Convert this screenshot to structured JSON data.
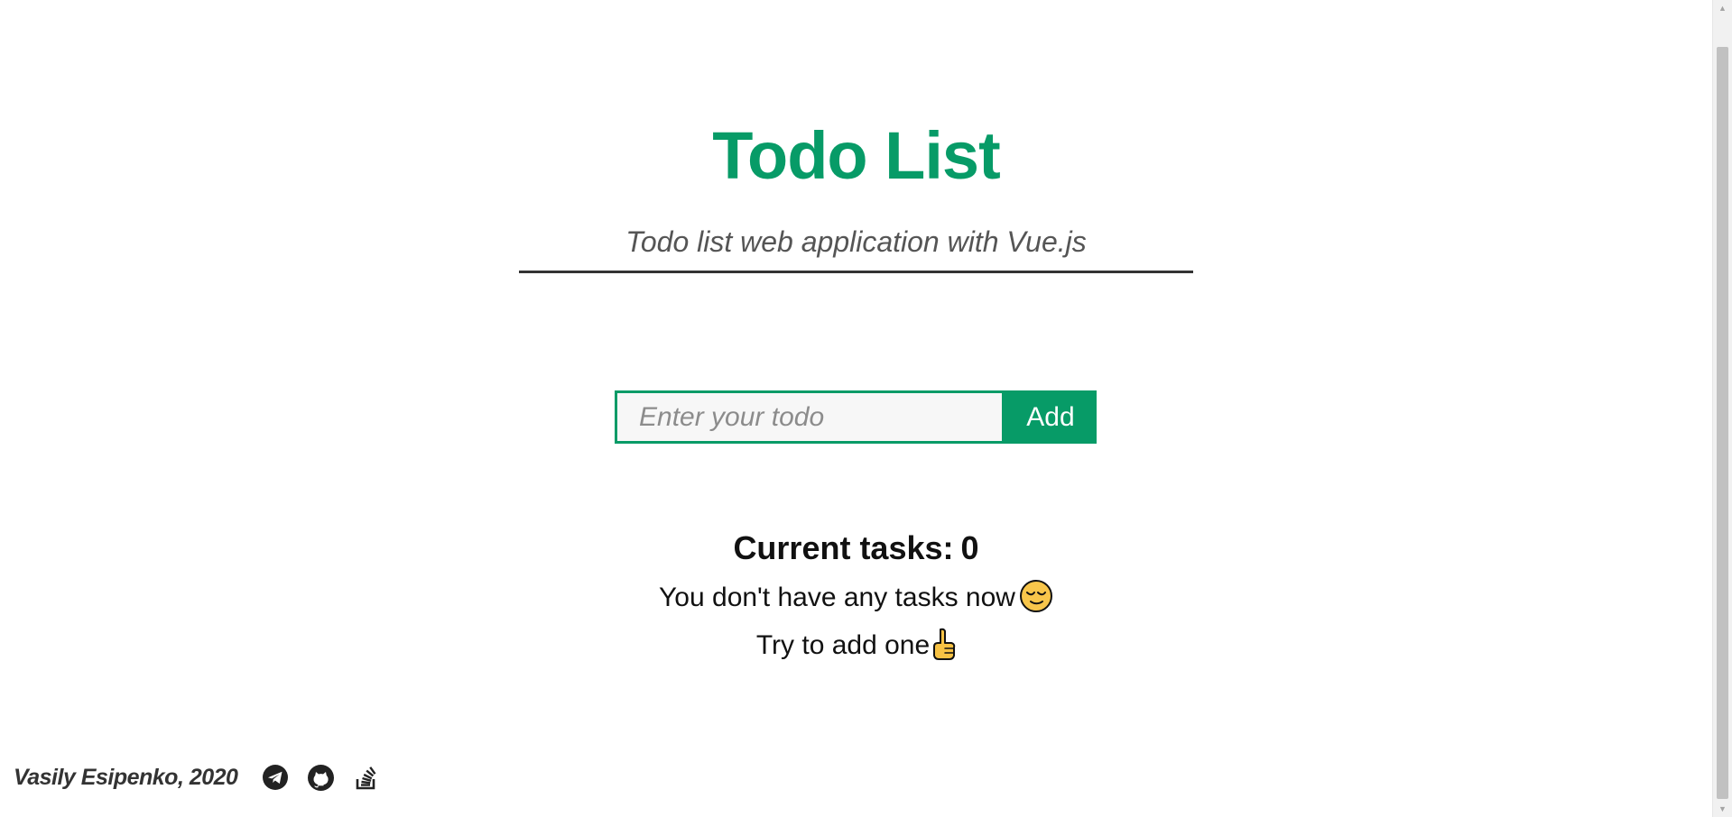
{
  "header": {
    "title": "Todo List",
    "subtitle": "Todo list web application with Vue.js"
  },
  "form": {
    "input_placeholder": "Enter your todo",
    "input_value": "",
    "add_label": "Add"
  },
  "tasks": {
    "label": "Current tasks:",
    "count": "0",
    "items": []
  },
  "empty_state": {
    "line1": "You don't have any tasks now",
    "line1_emoji": "relieved-face-icon",
    "line2": "Try to add one",
    "line2_emoji": "pointing-up-icon"
  },
  "footer": {
    "author": "Vasily Esipenko, 2020",
    "links": [
      {
        "icon": "telegram-icon"
      },
      {
        "icon": "github-icon"
      },
      {
        "icon": "stackoverflow-icon"
      }
    ]
  },
  "colors": {
    "accent": "#079b67",
    "subtitle": "#555555",
    "divider": "#333333",
    "text": "#111111"
  }
}
